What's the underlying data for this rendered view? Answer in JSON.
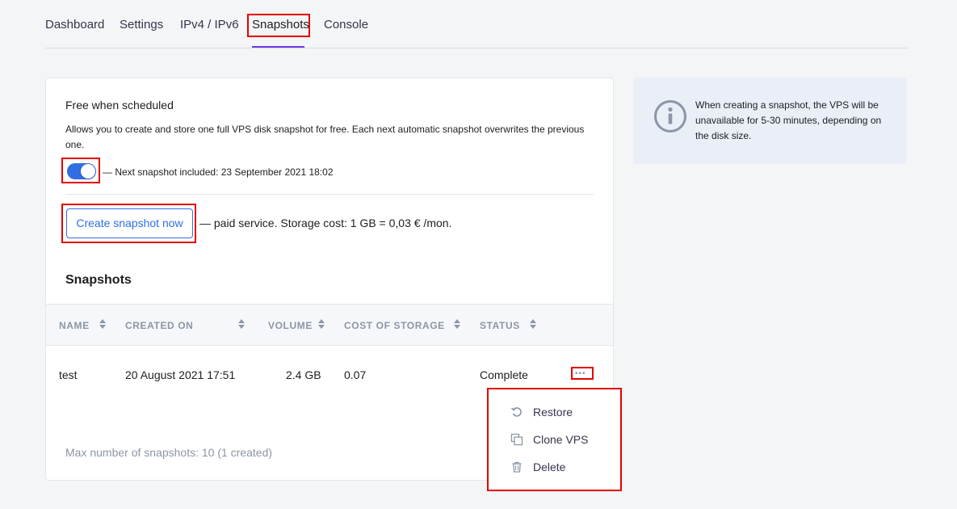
{
  "tabs": [
    {
      "label": "Dashboard"
    },
    {
      "label": "Settings"
    },
    {
      "label": "IPv4 / IPv6"
    },
    {
      "label": "Snapshots"
    },
    {
      "label": "Console"
    }
  ],
  "active_tab": "Snapshots",
  "free": {
    "title": "Free when scheduled",
    "description": "Allows you to create and store one full VPS disk snapshot for free. Each next automatic snapshot overwrites the previous one.",
    "toggle_on": true,
    "toggle_text": "— Next snapshot included: 23 September 2021 18:02"
  },
  "create": {
    "button_label": "Create snapshot now",
    "text": "— paid service. Storage cost: 1 GB = 0,03 € /mon."
  },
  "snapshots": {
    "title": "Snapshots",
    "columns": [
      "NAME",
      "CREATED ON",
      "VOLUME",
      "COST OF STORAGE",
      "STATUS"
    ],
    "rows": [
      {
        "name": "test",
        "created_on": "20 August 2021 17:51",
        "volume": "2.4 GB",
        "cost": "0.07",
        "status": "Complete"
      }
    ],
    "more_label": "•••",
    "max_text": "Max number of snapshots: 10 (1 created)"
  },
  "menu": {
    "items": [
      {
        "label": "Restore",
        "icon": "restore-icon"
      },
      {
        "label": "Clone VPS",
        "icon": "copy-icon"
      },
      {
        "label": "Delete",
        "icon": "trash-icon"
      }
    ]
  },
  "info": {
    "icon": "info-icon",
    "text": "When creating a snapshot, the VPS will be unavailable for 5-30 minutes, depending on the disk size."
  },
  "colors": {
    "accent": "#2f6fe3",
    "highlight": "#e50000",
    "tab_underline": "#673de6",
    "info_bg": "#e9eef7",
    "muted": "#8c96a6"
  }
}
